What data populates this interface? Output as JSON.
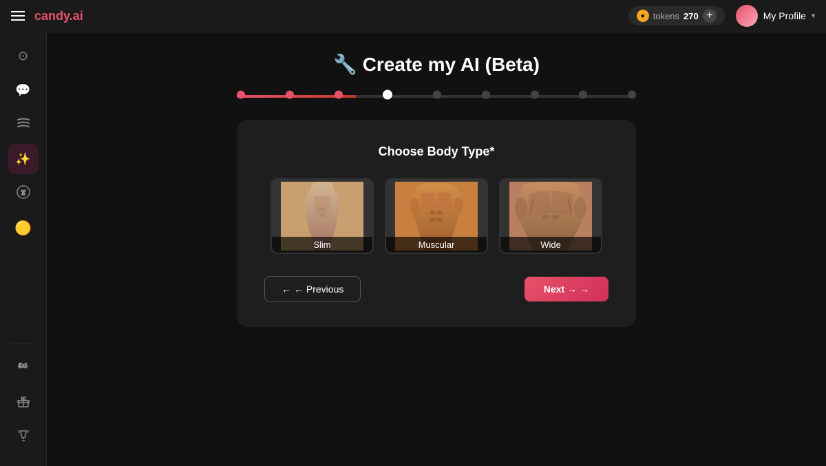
{
  "brand": {
    "name": "candy",
    "tld": ".ai"
  },
  "topnav": {
    "tokens_label": "tokens",
    "tokens_count": "270",
    "add_token_label": "+",
    "profile_label": "My Profile"
  },
  "sidebar": {
    "items_top": [
      {
        "id": "compass",
        "icon": "🧭",
        "label": "Explore"
      },
      {
        "id": "chat",
        "icon": "💬",
        "label": "Chat"
      },
      {
        "id": "waves",
        "icon": "〰️",
        "label": "Feed"
      },
      {
        "id": "sparkles",
        "icon": "✨",
        "label": "Create",
        "active": true
      },
      {
        "id": "github",
        "icon": "⬡",
        "label": "GitHub"
      },
      {
        "id": "coin",
        "icon": "🟡",
        "label": "Tokens"
      }
    ],
    "items_bottom": [
      {
        "id": "discord",
        "icon": "💠",
        "label": "Discord"
      },
      {
        "id": "gift",
        "icon": "🎁",
        "label": "Referral"
      },
      {
        "id": "trophy",
        "icon": "🏆",
        "label": "Leaderboard"
      }
    ]
  },
  "page": {
    "title": "🔧 Create my AI (Beta)",
    "progress": {
      "total_steps": 9,
      "completed_steps": 3,
      "current_step": 4
    }
  },
  "card": {
    "title": "Choose Body Type*",
    "body_types": [
      {
        "id": "slim",
        "label": "Slim"
      },
      {
        "id": "muscular",
        "label": "Muscular"
      },
      {
        "id": "wide",
        "label": "Wide"
      }
    ],
    "btn_previous": "← Previous",
    "btn_next": "Next →"
  }
}
